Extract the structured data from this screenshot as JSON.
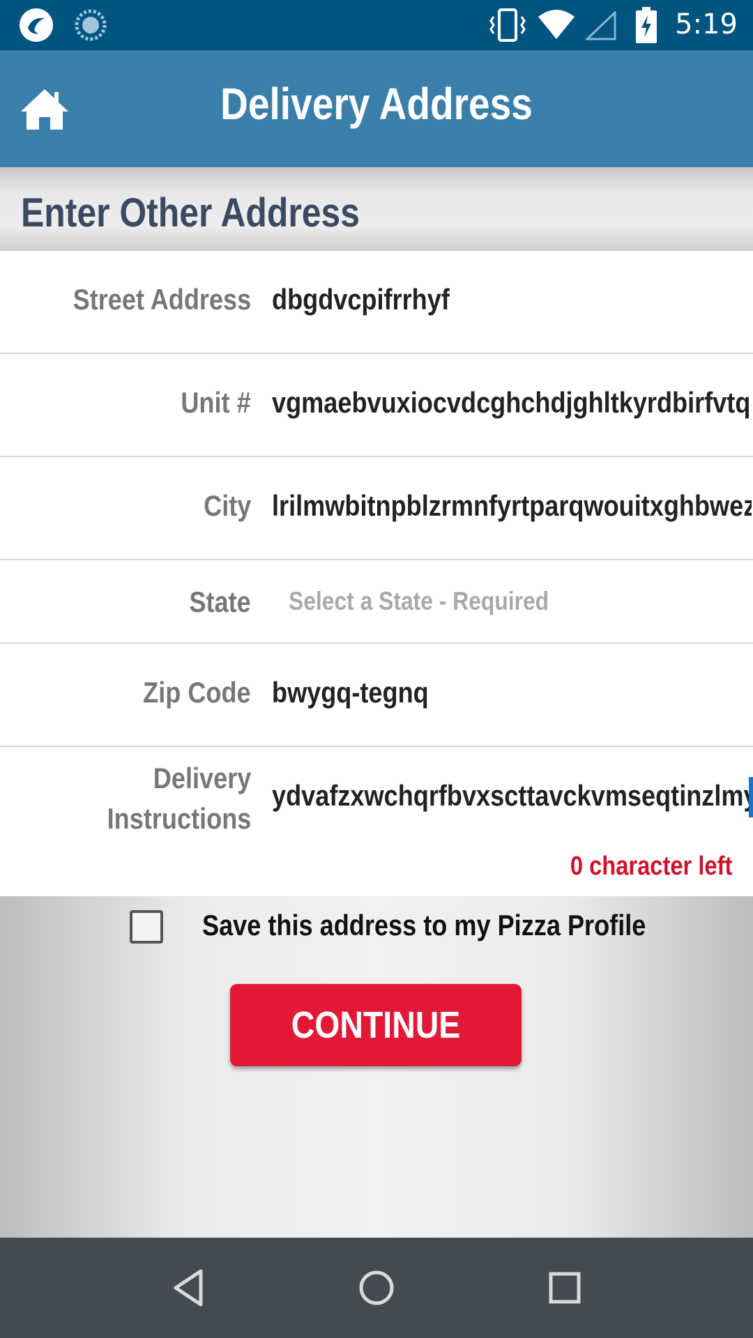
{
  "status_bar": {
    "time": "5:19"
  },
  "app_bar": {
    "title": "Delivery Address"
  },
  "section": {
    "title": "Enter Other Address"
  },
  "form": {
    "street_label": "Street Address",
    "street_value": "dbgdvcpifrrhyf",
    "unit_label": "Unit #",
    "unit_value": "vgmaebvuxiocvdcghchdjghltkyrdbirfvtqe",
    "city_label": "City",
    "city_value": "lrilmwbitnpblzrmnfyrtparqwouitxghbwez",
    "state_label": "State",
    "state_placeholder": "Select a State - Required",
    "zip_label": "Zip Code",
    "zip_value": "bwygq-tegnq",
    "instructions_label_line1": "Delivery",
    "instructions_label_line2": "Instructions",
    "instructions_value": "ydvafzxwchqrfbvxscttavckvmseqtinzlmy",
    "counter": "0 character left"
  },
  "save_checkbox": {
    "label": "Save this address to my Pizza Profile",
    "checked": false
  },
  "continue_button": {
    "label": "CONTINUE"
  },
  "colors": {
    "status_bar": "#005580",
    "app_bar": "#3a7fa9",
    "accent": "#e31837",
    "nav_bar": "#434a50"
  }
}
